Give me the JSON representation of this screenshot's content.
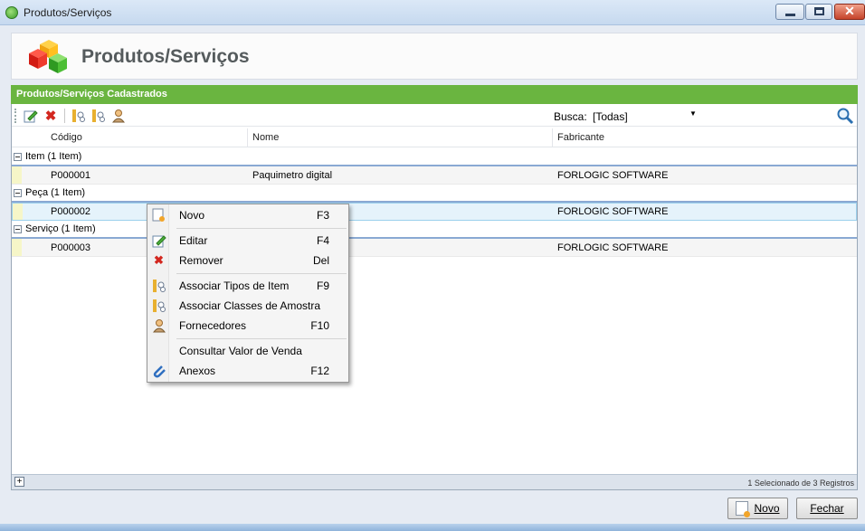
{
  "window": {
    "title": "Produtos/Serviços"
  },
  "header": {
    "title": "Produtos/Serviços"
  },
  "panel": {
    "title": "Produtos/Serviços Cadastrados"
  },
  "toolbar": {
    "busca_label": "Busca:",
    "busca_value": "[Todas]",
    "busca_input": ""
  },
  "grid": {
    "columns": [
      "Código",
      "Nome",
      "Fabricante"
    ],
    "groups": [
      {
        "label": "Item (1 Item)",
        "rows": [
          {
            "codigo": "P000001",
            "nome": "Paquimetro digital",
            "fabricante": "FORLOGIC SOFTWARE"
          }
        ]
      },
      {
        "label": "Peça (1 Item)",
        "rows": [
          {
            "codigo": "P000002",
            "nome": "",
            "fabricante": "FORLOGIC SOFTWARE"
          }
        ]
      },
      {
        "label": "Serviço (1 Item)",
        "rows": [
          {
            "codigo": "P000003",
            "nome": "",
            "fabricante": "FORLOGIC SOFTWARE"
          }
        ]
      }
    ]
  },
  "status": {
    "text": "1 Selecionado de 3 Registros"
  },
  "buttons": {
    "novo": "Novo",
    "fechar": "Fechar"
  },
  "context_menu": [
    {
      "label": "Novo",
      "shortcut": "F3",
      "icon": "new-document-icon"
    },
    {
      "label": "Editar",
      "shortcut": "F4",
      "icon": "edit-icon"
    },
    {
      "label": "Remover",
      "shortcut": "Del",
      "icon": "delete-icon"
    },
    {
      "label": "Associar Tipos de Item",
      "shortcut": "F9",
      "icon": "associate-icon"
    },
    {
      "label": "Associar Classes de Amostra",
      "shortcut": "",
      "icon": "associate-icon"
    },
    {
      "label": "Fornecedores",
      "shortcut": "F10",
      "icon": "user-icon"
    },
    {
      "label": "Consultar Valor de Venda",
      "shortcut": "",
      "icon": ""
    },
    {
      "label": "Anexos",
      "shortcut": "F12",
      "icon": "paperclip-icon"
    }
  ],
  "colors": {
    "accent_green": "#6ab540",
    "selected_row": "#e5f3fb",
    "group_line": "#8aa9d3"
  }
}
